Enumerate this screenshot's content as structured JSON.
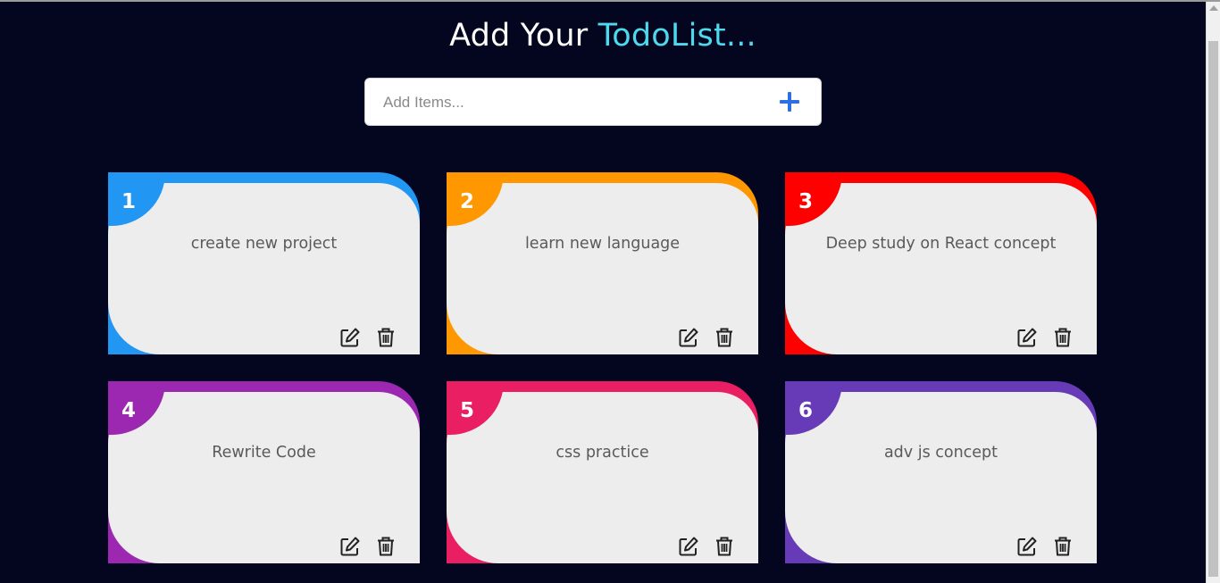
{
  "header": {
    "title_main": "Add Your ",
    "title_accent": "TodoList..."
  },
  "input": {
    "placeholder": "Add Items...",
    "value": "",
    "add_icon": "plus-icon"
  },
  "todos": [
    {
      "number": "1",
      "text": "create new project",
      "color": "#2196f3"
    },
    {
      "number": "2",
      "text": "learn new language",
      "color": "#ff9800"
    },
    {
      "number": "3",
      "text": "Deep study on React concept",
      "color": "#ff0000"
    },
    {
      "number": "4",
      "text": "Rewrite Code",
      "color": "#9c27b0"
    },
    {
      "number": "5",
      "text": "css practice",
      "color": "#e91e63"
    },
    {
      "number": "6",
      "text": "adv js concept",
      "color": "#673ab7"
    }
  ],
  "actions": {
    "edit_icon": "edit-icon",
    "delete_icon": "trash-icon"
  },
  "colors": {
    "background": "#04061f",
    "accent": "#4fd9ec",
    "plus": "#2f6fe4",
    "card": "#ededed"
  }
}
